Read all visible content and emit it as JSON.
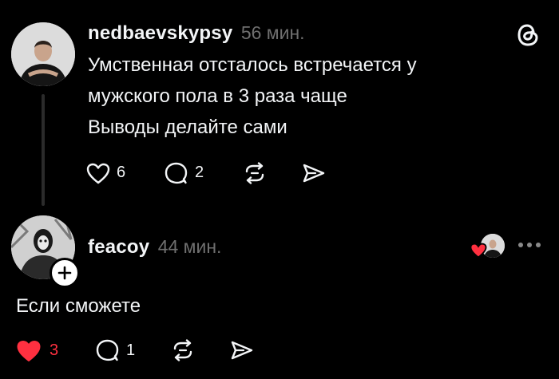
{
  "post": {
    "username": "nedbaevskypsy",
    "time": "56 мин.",
    "lines": [
      "Умственная отсталось встречается у",
      "мужского пола в 3 раза чаще",
      "Выводы делайте сами"
    ],
    "likes": "6",
    "replies": "2"
  },
  "reply": {
    "username": "feacoy",
    "time": "44 мин.",
    "text": "Если сможете",
    "likes": "3",
    "replies": "1"
  },
  "colors": {
    "background": "#000000",
    "text": "#f3f5f7",
    "muted": "#6f6f6f",
    "like_active": "#ff3040"
  },
  "icons": [
    "threads-logo-icon",
    "heart-icon",
    "comment-icon",
    "repost-icon",
    "share-icon",
    "more-icon",
    "plus-icon"
  ]
}
